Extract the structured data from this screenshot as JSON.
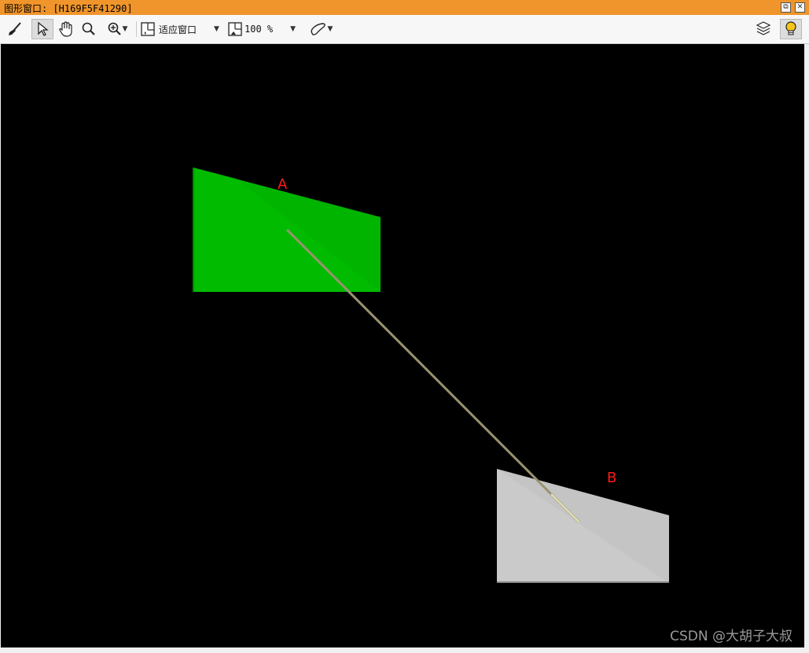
{
  "window": {
    "title": "图形窗口: [H169F5F41290]",
    "restore_symbol": "⧉",
    "close_symbol": "✕"
  },
  "toolbar": {
    "icons": [
      "broom-icon",
      "select-arrow-icon",
      "pan-hand-icon",
      "zoom-icon",
      "zoom-in-icon",
      "fit-window-icon",
      "zoom-percent-icon",
      "shape-tool-icon",
      "layers-icon",
      "lightbulb-icon"
    ],
    "fit_label": "适应窗口",
    "zoom_value": "100 %"
  },
  "scene": {
    "label_a": "A",
    "label_b": "B",
    "colors": {
      "background": "#000000",
      "surface_a": "#00b400",
      "surface_b": "#c4c4c4",
      "ray": "#9a9370",
      "label": "#ff1a1a"
    }
  },
  "watermark": "CSDN @大胡子大叔"
}
